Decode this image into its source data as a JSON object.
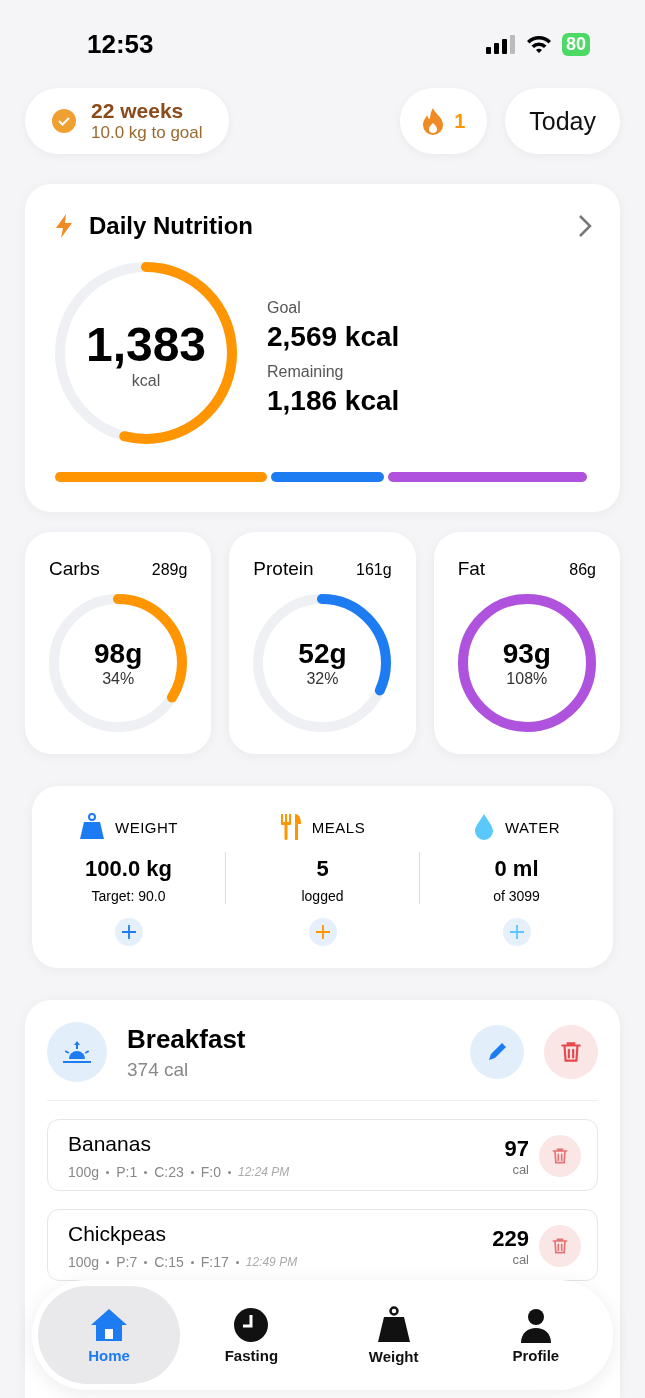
{
  "status_bar": {
    "time": "12:53",
    "battery": "80"
  },
  "header": {
    "plan_title": "22 weeks",
    "plan_subtitle": "10.0 kg to goal",
    "streak": "1",
    "date_button": "Today"
  },
  "daily_nutrition": {
    "title": "Daily Nutrition",
    "consumed": "1,383",
    "unit": "kcal",
    "goal_label": "Goal",
    "goal": "2,569 kcal",
    "remaining_label": "Remaining",
    "remaining": "1,186 kcal",
    "split": [
      {
        "color": "#ff9500"
      },
      {
        "color": "#1e7cf2"
      },
      {
        "color": "#af52de"
      }
    ]
  },
  "macros": [
    {
      "name": "Carbs",
      "target": "289g",
      "value": "98g",
      "percent": "34%",
      "color": "#ff9500"
    },
    {
      "name": "Protein",
      "target": "161g",
      "value": "52g",
      "percent": "32%",
      "color": "#1e7cf2"
    },
    {
      "name": "Fat",
      "target": "86g",
      "value": "93g",
      "percent": "108%",
      "color": "#af52de"
    }
  ],
  "stats": [
    {
      "kind": "weight",
      "label": "WEIGHT",
      "value": "100.0 kg",
      "sub": "Target: 90.0",
      "color": "#1e7cf2"
    },
    {
      "kind": "meals",
      "label": "MEALS",
      "value": "5",
      "sub": "logged",
      "color": "#ff9500"
    },
    {
      "kind": "water",
      "label": "WATER",
      "value": "0 ml",
      "sub": "of 3099",
      "color": "#5ac8fa"
    }
  ],
  "meal": {
    "title": "Breakfast",
    "calories": "374 cal",
    "items": [
      {
        "name": "Bananas",
        "amount": "100g",
        "macros": [
          "P:1",
          "C:23",
          "F:0"
        ],
        "time": "12:24 PM",
        "calories": "97",
        "unit": "cal"
      },
      {
        "name": "Chickpeas",
        "amount": "100g",
        "macros": [
          "P:7",
          "C:15",
          "F:17"
        ],
        "time": "12:49 PM",
        "calories": "229",
        "unit": "cal"
      }
    ]
  },
  "tabs": [
    {
      "label": "Home",
      "selected": true
    },
    {
      "label": "Fasting",
      "selected": false
    },
    {
      "label": "Weight",
      "selected": false
    },
    {
      "label": "Profile",
      "selected": false
    }
  ]
}
